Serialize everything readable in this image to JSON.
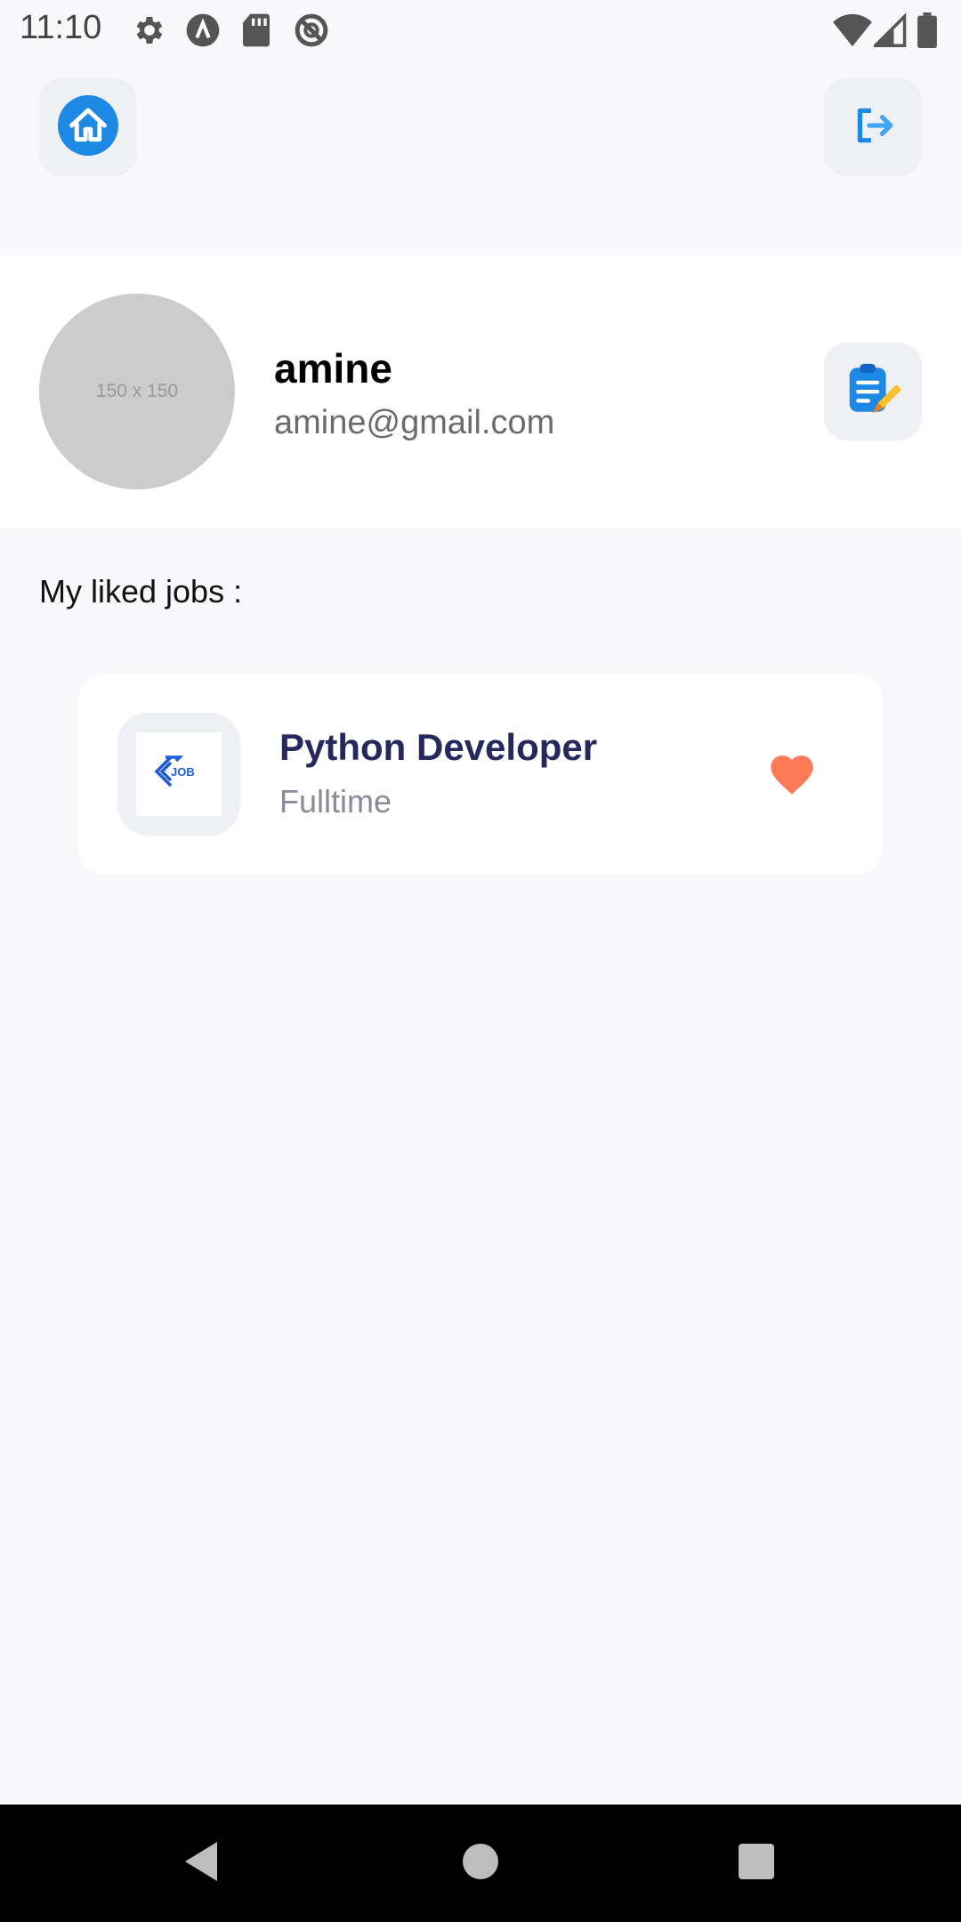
{
  "status_bar": {
    "time": "11:10",
    "left_icons": [
      "settings-icon",
      "android-icon",
      "sd-card-icon",
      "do-not-disturb-icon"
    ],
    "right_icons": [
      "wifi-icon",
      "signal-icon",
      "battery-icon"
    ]
  },
  "header": {
    "home_icon": "home-icon",
    "logout_icon": "logout-icon",
    "accent": "#2196F3"
  },
  "profile": {
    "avatar_placeholder": "150 x 150",
    "name": "amine",
    "email": "amine@gmail.com",
    "edit_icon": "edit-profile-icon"
  },
  "liked_jobs": {
    "title": "My liked jobs :",
    "items": [
      {
        "logo_text": "JOB",
        "title": "Python Developer",
        "type": "Fulltime",
        "liked": true,
        "heart_color": "#FF7A57"
      }
    ]
  },
  "nav": {
    "icons": [
      "back-icon",
      "home-circle-icon",
      "recents-icon"
    ]
  }
}
